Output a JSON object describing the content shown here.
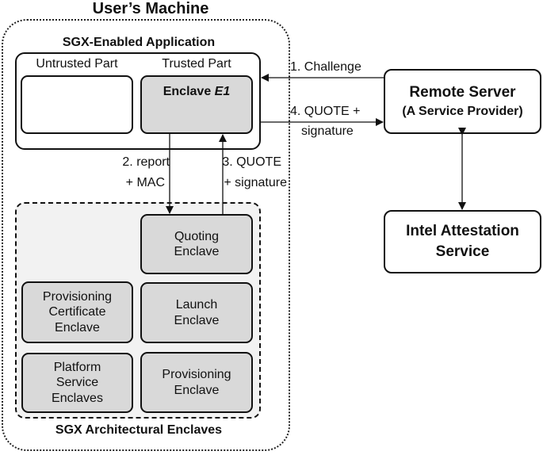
{
  "users_machine": {
    "title": "User’s Machine"
  },
  "sgx_app": {
    "title": "SGX-Enabled Application",
    "untrusted_label": "Untrusted Part",
    "trusted_label": "Trusted Part",
    "enclave_prefix": "Enclave ",
    "enclave_name": "E1"
  },
  "arch_enclaves": {
    "title": "SGX Architectural Enclaves",
    "items": [
      {
        "line1": "Quoting",
        "line2": "Enclave",
        "line3": ""
      },
      {
        "line1": "Provisioning",
        "line2": "Certificate",
        "line3": "Enclave"
      },
      {
        "line1": "Launch",
        "line2": "Enclave",
        "line3": ""
      },
      {
        "line1": "Platform",
        "line2": "Service",
        "line3": "Enclaves"
      },
      {
        "line1": "Provisioning",
        "line2": "Enclave",
        "line3": ""
      }
    ]
  },
  "remote_server": {
    "line1": "Remote Server",
    "line2": "(A Service Provider)"
  },
  "intel_service": {
    "line1": "Intel Attestation",
    "line2": "Service"
  },
  "arrows": {
    "step1": "1. Challenge",
    "step2_line1": "2. report",
    "step2_line2": "+ MAC",
    "step3_line1": "3. QUOTE",
    "step3_line2": "+ signature",
    "step4_line1": "4. QUOTE +",
    "step4_line2": "signature"
  }
}
